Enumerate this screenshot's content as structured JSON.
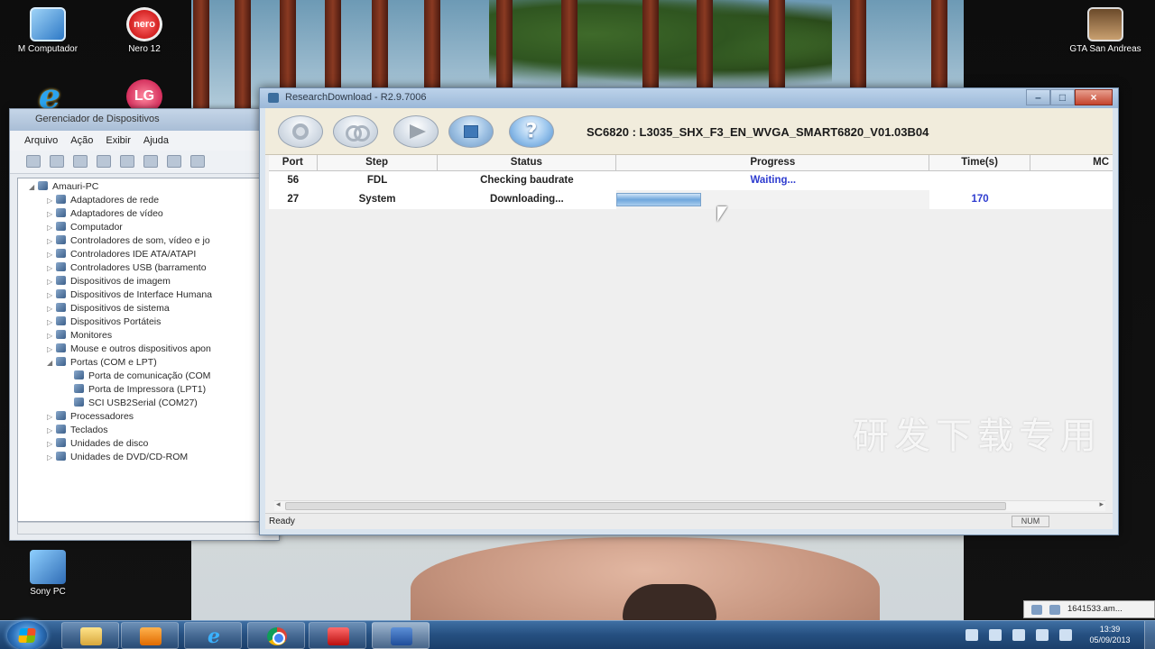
{
  "desktop": {
    "icons": [
      {
        "label": "M Computador",
        "icon": "computer-icon"
      },
      {
        "label": "Nero 12",
        "icon": "nero-icon",
        "badge": "nero"
      },
      {
        "label": "GTA San Andreas",
        "icon": "gta-icon"
      },
      {
        "label": "Sony PC",
        "icon": "sony-pc-icon"
      },
      {
        "label": "",
        "icon": "internet-explorer-icon",
        "glyph": "e"
      },
      {
        "label": "",
        "icon": "lg-icon",
        "glyph": "LG"
      }
    ]
  },
  "device_manager": {
    "title": "Gerenciador de Dispositivos",
    "menu": [
      "Arquivo",
      "Ação",
      "Exibir",
      "Ajuda"
    ],
    "tree": [
      {
        "label": "Amauri-PC",
        "level": 0,
        "expander": "◢"
      },
      {
        "label": "Adaptadores de rede",
        "level": 1,
        "expander": "▷"
      },
      {
        "label": "Adaptadores de vídeo",
        "level": 1,
        "expander": "▷"
      },
      {
        "label": "Computador",
        "level": 1,
        "expander": "▷"
      },
      {
        "label": "Controladores de som, vídeo e jo",
        "level": 1,
        "expander": "▷"
      },
      {
        "label": "Controladores IDE ATA/ATAPI",
        "level": 1,
        "expander": "▷"
      },
      {
        "label": "Controladores USB (barramento",
        "level": 1,
        "expander": "▷"
      },
      {
        "label": "Dispositivos de imagem",
        "level": 1,
        "expander": "▷"
      },
      {
        "label": "Dispositivos de Interface Humana",
        "level": 1,
        "expander": "▷"
      },
      {
        "label": "Dispositivos de sistema",
        "level": 1,
        "expander": "▷"
      },
      {
        "label": "Dispositivos Portáteis",
        "level": 1,
        "expander": "▷"
      },
      {
        "label": "Monitores",
        "level": 1,
        "expander": "▷"
      },
      {
        "label": "Mouse e outros dispositivos apon",
        "level": 1,
        "expander": "▷"
      },
      {
        "label": "Portas (COM e LPT)",
        "level": 1,
        "expander": "◢"
      },
      {
        "label": "Porta de comunicação (COM",
        "level": 2,
        "expander": ""
      },
      {
        "label": "Porta de Impressora (LPT1)",
        "level": 2,
        "expander": ""
      },
      {
        "label": "SCI USB2Serial (COM27)",
        "level": 2,
        "expander": ""
      },
      {
        "label": "Processadores",
        "level": 1,
        "expander": "▷"
      },
      {
        "label": "Teclados",
        "level": 1,
        "expander": "▷"
      },
      {
        "label": "Unidades de disco",
        "level": 1,
        "expander": "▷"
      },
      {
        "label": "Unidades de DVD/CD-ROM",
        "level": 1,
        "expander": "▷"
      }
    ]
  },
  "research_download": {
    "title": "ResearchDownload - R2.9.7006",
    "window_buttons": {
      "minimize": "–",
      "maximize": "□",
      "close": "×"
    },
    "firmware": "SC6820 : L3035_SHX_F3_EN_WVGA_SMART6820_V01.03B04",
    "toolbar_buttons": [
      "settings-icon",
      "load-packet-icon",
      "start-downloading-icon",
      "stop-downloading-icon",
      "help-icon"
    ],
    "help_glyph": "?",
    "columns": [
      "Port",
      "Step",
      "Status",
      "Progress",
      "Time(s)",
      "MC"
    ],
    "rows": [
      {
        "port": "56",
        "step": "FDL",
        "status": "Checking baudrate",
        "progress_text": "Waiting...",
        "progress": null,
        "time": ""
      },
      {
        "port": "27",
        "step": "System",
        "status": "Downloading...",
        "progress_text": "",
        "progress": 0.27,
        "time": "170"
      }
    ],
    "watermark": "研发下载专用",
    "status_text": "Ready",
    "status_panel": "NUM"
  },
  "taskbar": {
    "apps": [
      "windows-explorer-icon",
      "media-player-icon",
      "internet-explorer-icon",
      "chrome-icon",
      "app-red-icon",
      "research-download-icon"
    ],
    "ie_glyph": "e",
    "clock_time": "13:39",
    "clock_date": "05/09/2013",
    "notification": "1641533.am..."
  },
  "colors": {
    "accent_blue": "#2d3bcf",
    "taskbar": "#254f80",
    "toolbar_bg": "#f1ecdc"
  }
}
